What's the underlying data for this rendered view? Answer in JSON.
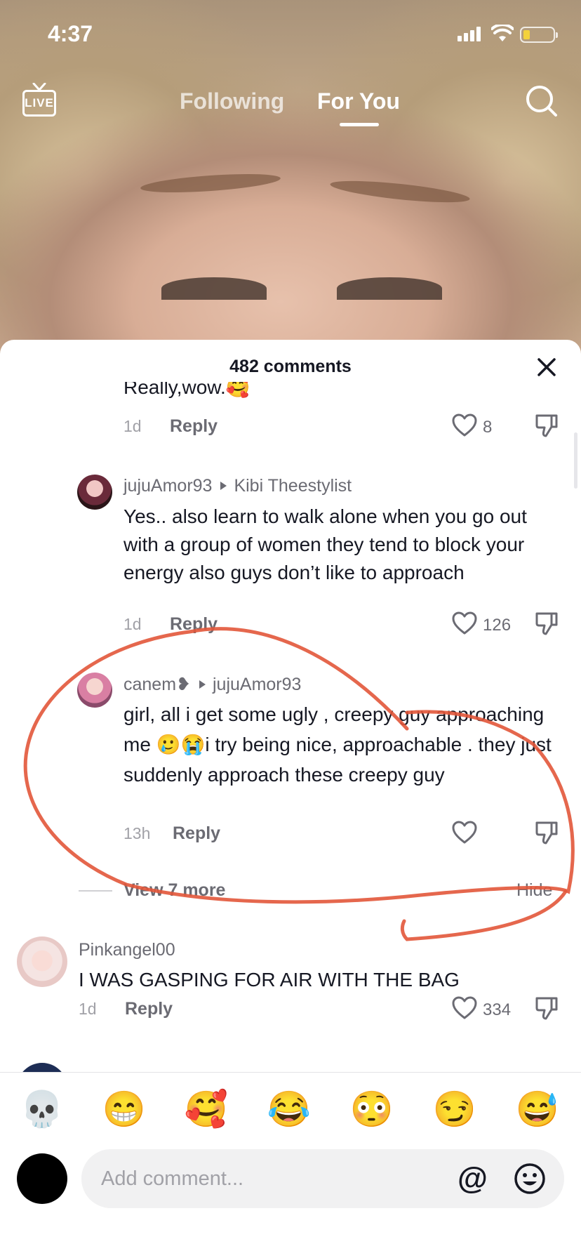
{
  "status_bar": {
    "time": "4:37",
    "battery_color": "#f3d23c"
  },
  "top_nav": {
    "live_label": "LIVE",
    "tabs": [
      {
        "label": "Following",
        "active": false
      },
      {
        "label": "For You",
        "active": true
      }
    ]
  },
  "comments_sheet": {
    "title": "482 comments",
    "comments": [
      {
        "text": "Really,wow.🥰",
        "time": "1d",
        "reply_label": "Reply",
        "likes": "8"
      },
      {
        "author": "jujuAmor93",
        "reply_to": "Kibi Theestylist",
        "text": "Yes.. also learn to walk alone when you go out with a group of women they tend to block your energy also guys don’t like to approach",
        "time": "1d",
        "reply_label": "Reply",
        "likes": "126"
      },
      {
        "author": "canem❥",
        "reply_to": "jujuAmor93",
        "text": "girl, all i get some ugly , creepy guy approaching me 🥲😭i try being nice, approachable . they just suddenly approach these creepy guy",
        "time": "13h",
        "reply_label": "Reply",
        "likes": ""
      },
      {
        "author": "Pinkangel00",
        "text": "I WAS GASPING FOR AIR WITH THE BAG",
        "time": "1d",
        "reply_label": "Reply",
        "likes": "334"
      }
    ],
    "view_more_label": "View 7 more",
    "hide_label": "Hide"
  },
  "emoji_bar": [
    "💀",
    "😁",
    "🥰",
    "😂",
    "😳",
    "😏",
    "😅"
  ],
  "comment_input": {
    "placeholder": "Add comment..."
  },
  "annotation_color": "#e2563a"
}
